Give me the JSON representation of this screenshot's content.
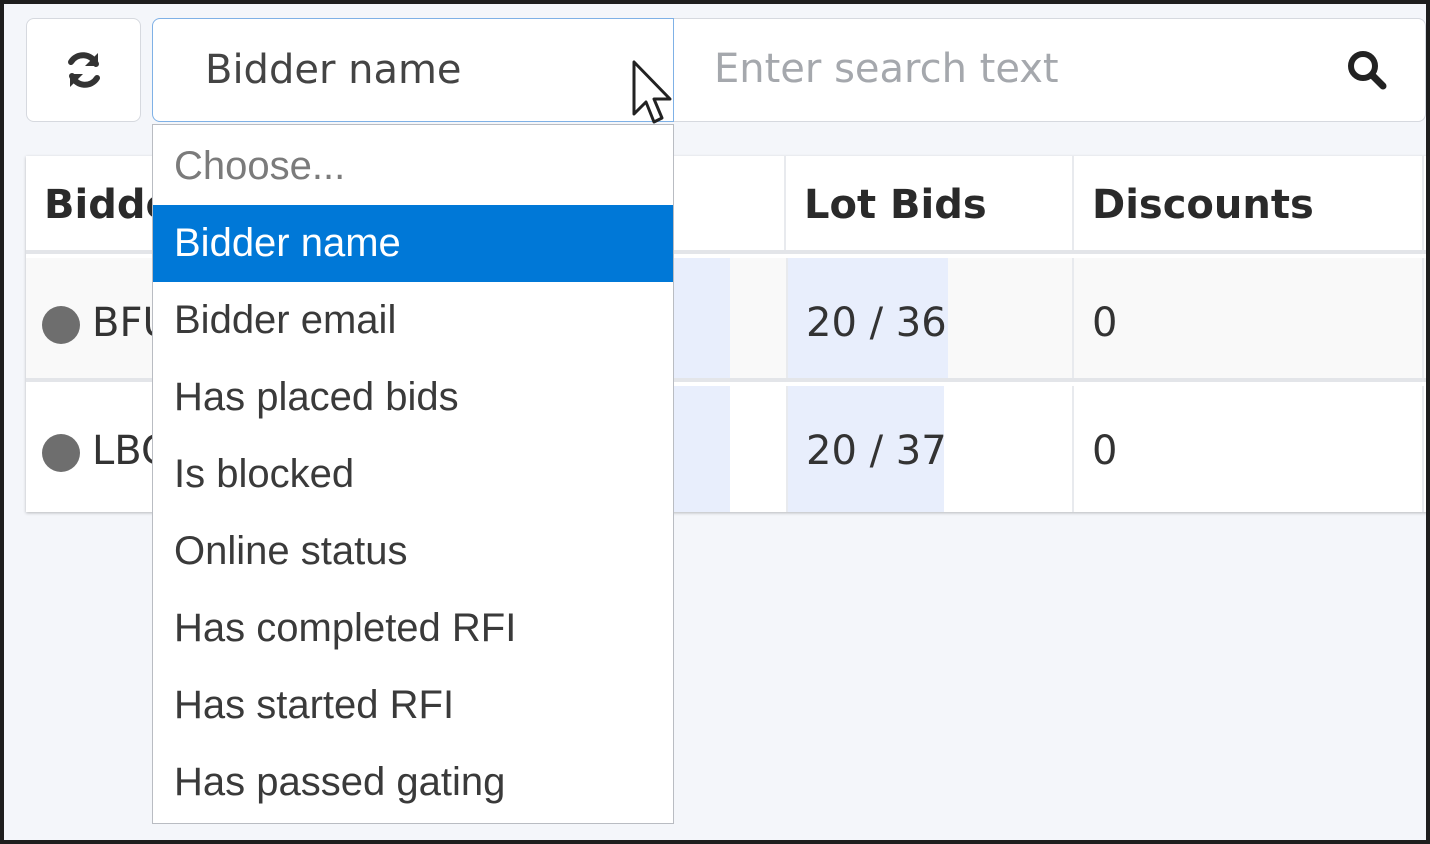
{
  "toolbar": {
    "refresh_icon": "refresh-icon",
    "select_value": "Bidder name",
    "search_placeholder": "Enter search text",
    "search_icon": "search-icon"
  },
  "dropdown": {
    "options": [
      "Choose...",
      "Bidder name",
      "Bidder email",
      "Has placed bids",
      "Is blocked",
      "Online status",
      "Has completed RFI",
      "Has started RFI",
      "Has passed gating"
    ],
    "selected": "Bidder name"
  },
  "table": {
    "headers": [
      "Bidde",
      "Lot Bids",
      "Discounts"
    ],
    "rows": [
      {
        "bidder": "BFU",
        "lot_bids": "20 / 36",
        "discounts": "0"
      },
      {
        "bidder": "LBC",
        "lot_bids": "20 / 37",
        "discounts": "0"
      }
    ]
  },
  "colors": {
    "accent": "#0078d7",
    "highlight": "#e8eefc",
    "status_dot": "#6e6e6e"
  }
}
